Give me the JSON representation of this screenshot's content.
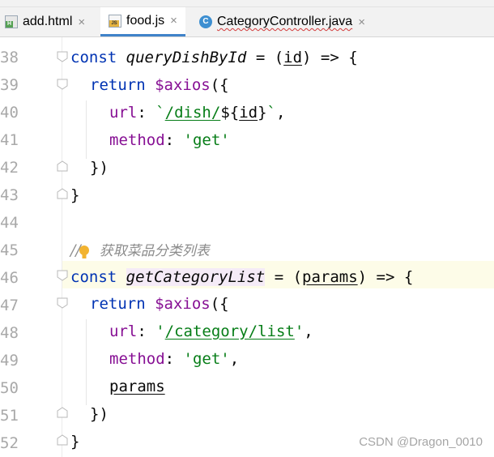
{
  "tabs": [
    {
      "label": "add.html",
      "icon": "html-file-icon",
      "active": false
    },
    {
      "label": "food.js",
      "icon": "js-file-icon",
      "active": true
    },
    {
      "label": "CategoryController.java",
      "icon": "java-class-icon",
      "active": false
    }
  ],
  "line_numbers": [
    "38",
    "39",
    "40",
    "41",
    "42",
    "43",
    "44",
    "45",
    "46",
    "47",
    "48",
    "49",
    "50",
    "51",
    "52"
  ],
  "code": {
    "l38": {
      "kw": "const",
      "fn": "queryDishById",
      "eq": " = (",
      "param": "id",
      "rest": ") => {"
    },
    "l39": {
      "kw": "return",
      "obj": "$axios",
      "rest": "({"
    },
    "l40": {
      "prop": "url",
      "colon": ": ",
      "tick": "`",
      "path": "/dish/",
      "interp": "${",
      "id": "id",
      "close": "}",
      "tick2": "`",
      "comma": ","
    },
    "l41": {
      "prop": "method",
      "colon": ": ",
      "val": "'get'"
    },
    "l42": {
      "text": "})"
    },
    "l43": {
      "text": "}"
    },
    "l45": {
      "slashes": "//",
      "comment": "获取菜品分类列表"
    },
    "l46": {
      "kw": "const",
      "fn": "getCategoryList",
      "eq": " = (",
      "param": "params",
      "rest": ") => {"
    },
    "l47": {
      "kw": "return",
      "obj": "$axios",
      "rest": "({"
    },
    "l48": {
      "prop": "url",
      "colon": ": ",
      "q1": "'",
      "path": "/category/list",
      "q2": "'",
      "comma": ","
    },
    "l49": {
      "prop": "method",
      "colon": ": ",
      "val": "'get'",
      "comma": ","
    },
    "l50": {
      "ident": "params"
    },
    "l51": {
      "text": "})"
    },
    "l52": {
      "text": "}"
    }
  },
  "watermark": "CSDN @Dragon_0010",
  "colors": {
    "keyword": "#0033b3",
    "string": "#067d17",
    "property": "#871094",
    "comment": "#8c8c8c",
    "line_number": "#a9a9a9",
    "active_tab_underline": "#4083c9"
  }
}
